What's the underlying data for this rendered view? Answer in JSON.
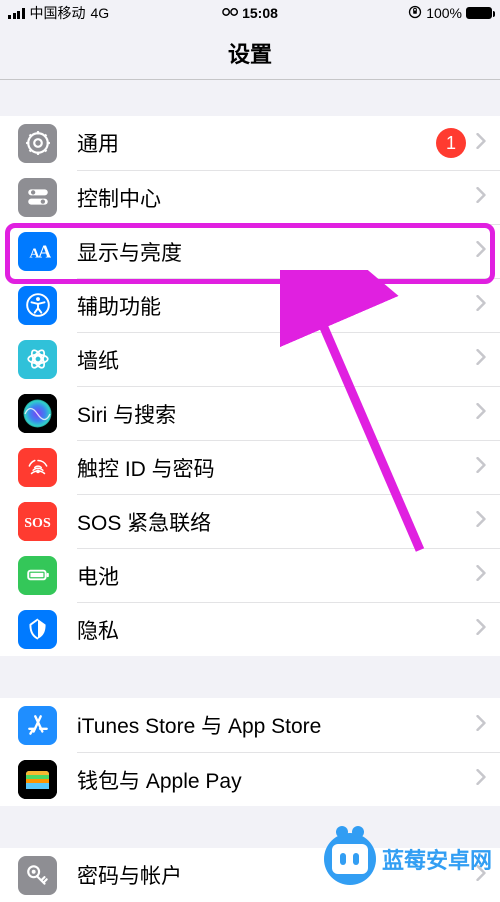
{
  "status": {
    "carrier": "中国移动",
    "network": "4G",
    "time": "15:08",
    "battery": "100%"
  },
  "header": {
    "title": "设置"
  },
  "section1": {
    "items": [
      {
        "label": "通用",
        "icon": "gear-icon",
        "bg": "#8e8e93",
        "badge": "1"
      },
      {
        "label": "控制中心",
        "icon": "switches-icon",
        "bg": "#8e8e93"
      },
      {
        "label": "显示与亮度",
        "icon": "text-size-icon",
        "bg": "#007aff"
      },
      {
        "label": "辅助功能",
        "icon": "accessibility-icon",
        "bg": "#007aff"
      },
      {
        "label": "墙纸",
        "icon": "wallpaper-icon",
        "bg": "#30c1d9"
      },
      {
        "label": "Siri 与搜索",
        "icon": "siri-icon",
        "bg": "#000"
      },
      {
        "label": "触控 ID 与密码",
        "icon": "fingerprint-icon",
        "bg": "#ff3b30"
      },
      {
        "label": "SOS 紧急联络",
        "icon": "sos-icon",
        "bg": "#ff3b30"
      },
      {
        "label": "电池",
        "icon": "battery-icon",
        "bg": "#34c759"
      },
      {
        "label": "隐私",
        "icon": "privacy-icon",
        "bg": "#007aff"
      }
    ]
  },
  "section2": {
    "items": [
      {
        "label": "iTunes Store 与 App Store",
        "icon": "appstore-icon",
        "bg": "#1f8eff"
      },
      {
        "label": "钱包与 Apple Pay",
        "icon": "wallet-icon",
        "bg": "#000"
      }
    ]
  },
  "section3": {
    "items": [
      {
        "label": "密码与帐户",
        "icon": "key-icon",
        "bg": "#8e8e93"
      }
    ]
  },
  "watermark": {
    "text": "蓝莓安卓网"
  }
}
